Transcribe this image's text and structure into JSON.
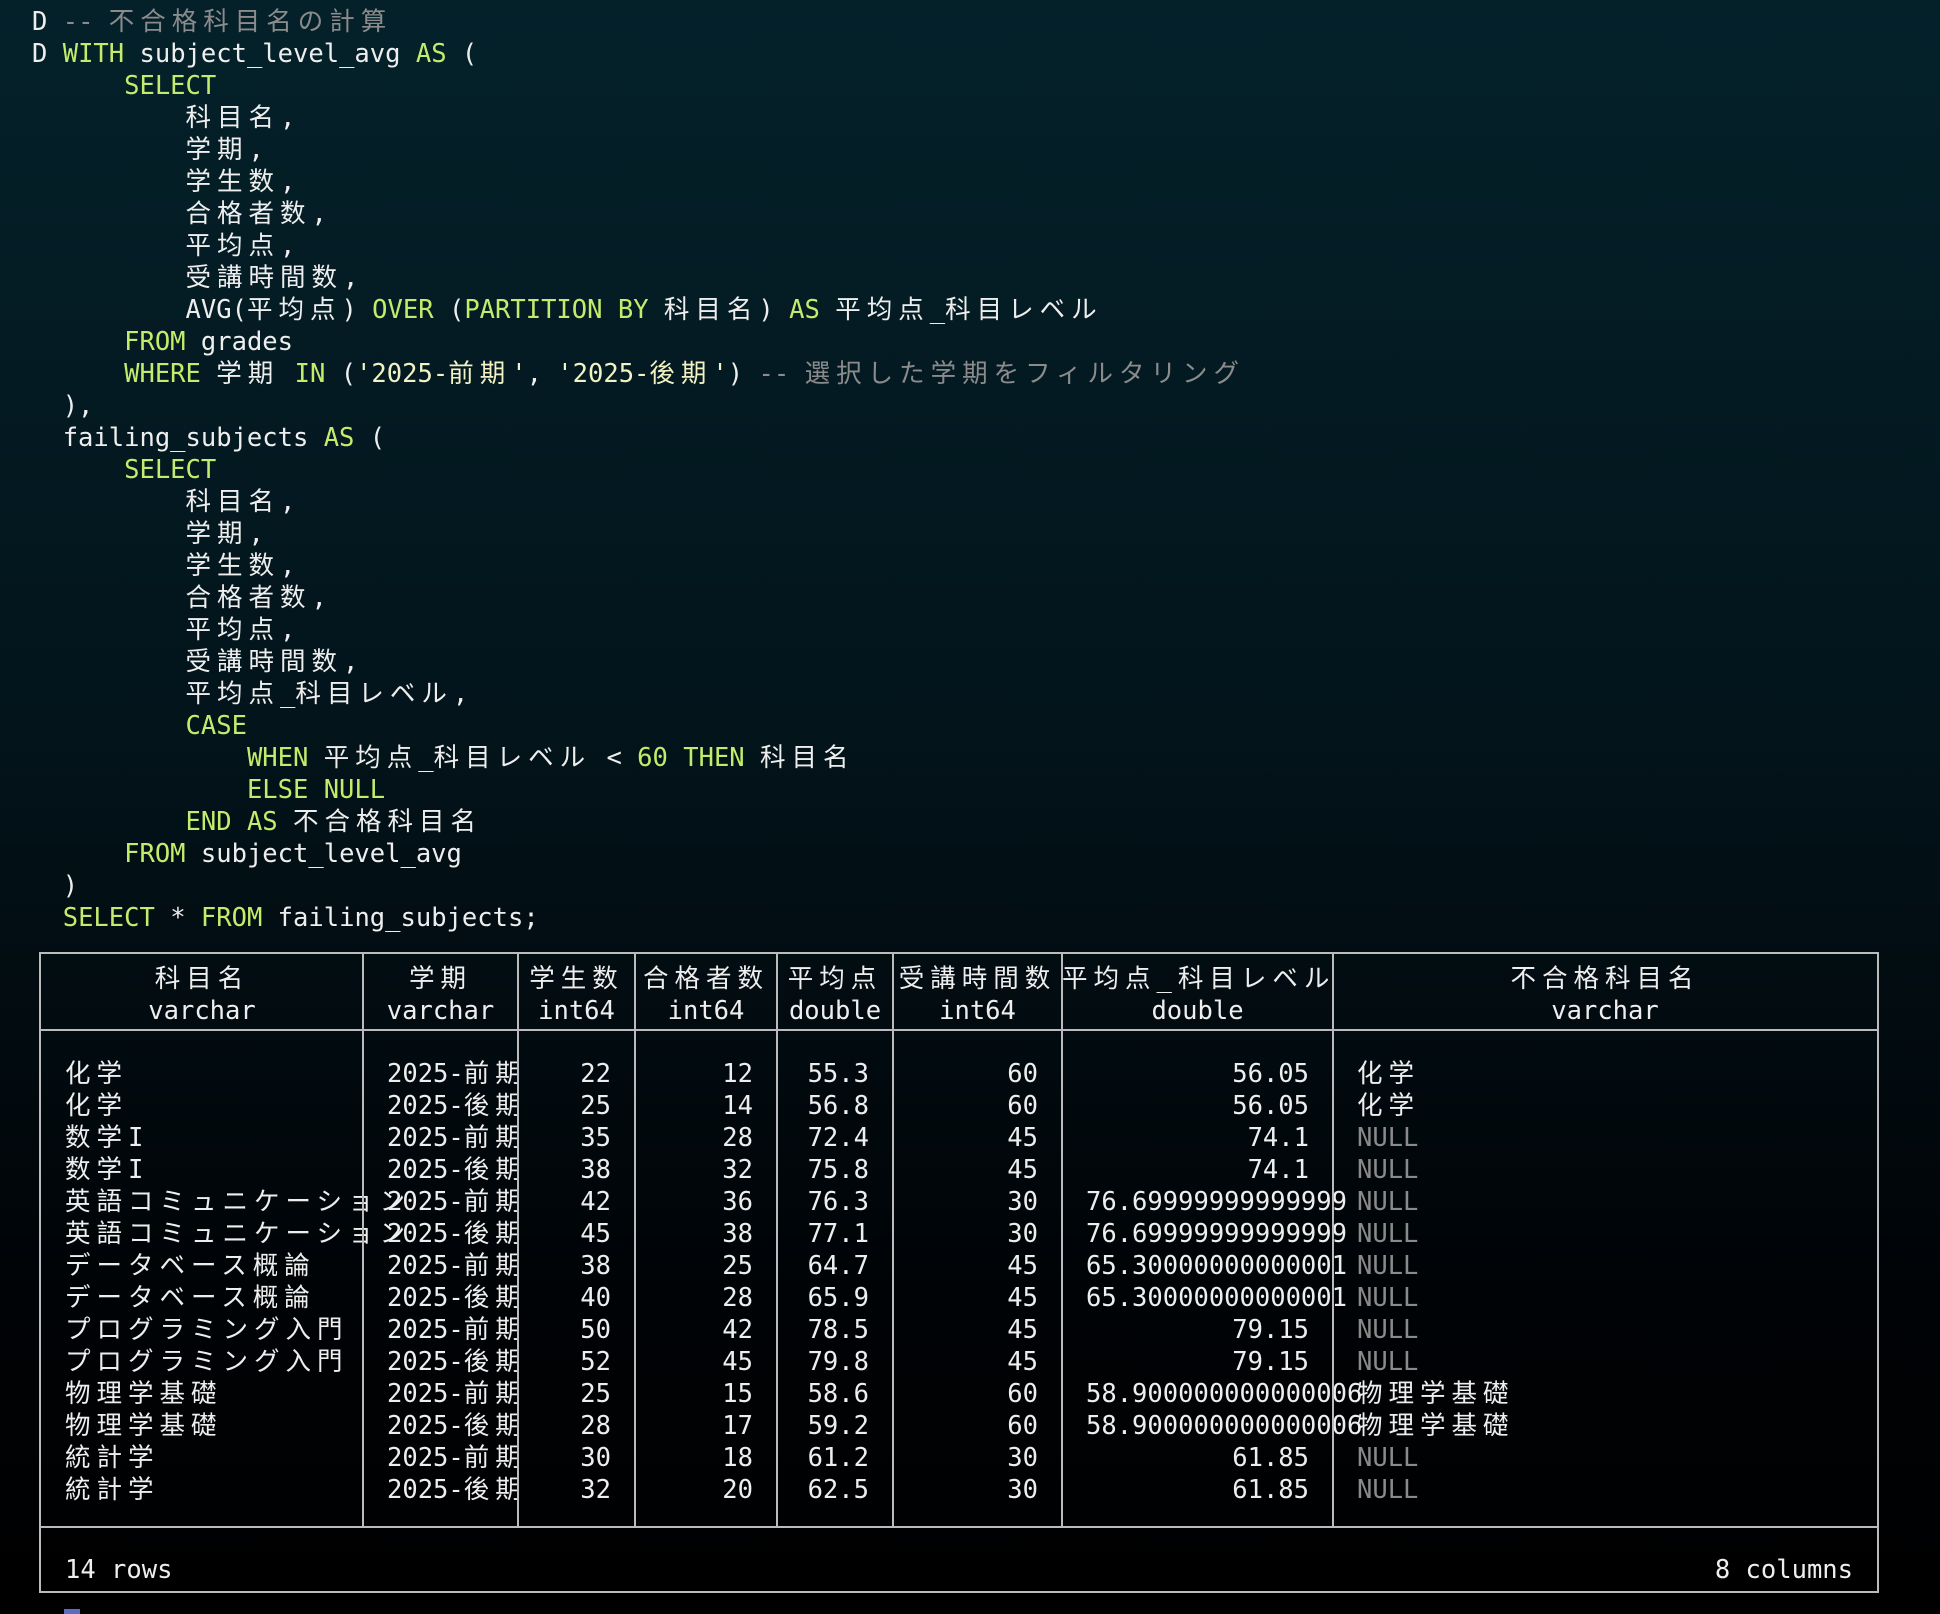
{
  "query_lines": [
    [
      [
        "p",
        "D "
      ],
      [
        "cmt",
        "-- 不合格科目名の計算"
      ]
    ],
    [
      [
        "p",
        "D "
      ],
      [
        "kw",
        "WITH"
      ],
      [
        "p",
        " subject_level_avg "
      ],
      [
        "kw",
        "AS"
      ],
      [
        "p",
        " ("
      ]
    ],
    [
      [
        "p",
        "      "
      ],
      [
        "kw",
        "SELECT"
      ]
    ],
    [
      [
        "p",
        "          科目名,"
      ]
    ],
    [
      [
        "p",
        "          学期,"
      ]
    ],
    [
      [
        "p",
        "          学生数,"
      ]
    ],
    [
      [
        "p",
        "          合格者数,"
      ]
    ],
    [
      [
        "p",
        "          平均点,"
      ]
    ],
    [
      [
        "p",
        "          受講時間数,"
      ]
    ],
    [
      [
        "p",
        "          AVG(平均点) "
      ],
      [
        "kw",
        "OVER"
      ],
      [
        "p",
        " ("
      ],
      [
        "kw",
        "PARTITION BY"
      ],
      [
        "p",
        " 科目名) "
      ],
      [
        "kw",
        "AS"
      ],
      [
        "p",
        " 平均点_科目レベル"
      ]
    ],
    [
      [
        "p",
        "      "
      ],
      [
        "kw",
        "FROM"
      ],
      [
        "p",
        " grades"
      ]
    ],
    [
      [
        "p",
        "      "
      ],
      [
        "kw",
        "WHERE"
      ],
      [
        "p",
        " 学期 "
      ],
      [
        "kw",
        "IN"
      ],
      [
        "p",
        " ("
      ],
      [
        "str",
        "'2025-前期'"
      ],
      [
        "p",
        ", "
      ],
      [
        "str",
        "'2025-後期'"
      ],
      [
        "p",
        ") "
      ],
      [
        "cmt",
        "-- 選択した学期をフィルタリング"
      ]
    ],
    [
      [
        "p",
        "  ),"
      ]
    ],
    [
      [
        "p",
        "  failing_subjects "
      ],
      [
        "kw",
        "AS"
      ],
      [
        "p",
        " ("
      ]
    ],
    [
      [
        "p",
        "      "
      ],
      [
        "kw",
        "SELECT"
      ]
    ],
    [
      [
        "p",
        "          科目名,"
      ]
    ],
    [
      [
        "p",
        "          学期,"
      ]
    ],
    [
      [
        "p",
        "          学生数,"
      ]
    ],
    [
      [
        "p",
        "          合格者数,"
      ]
    ],
    [
      [
        "p",
        "          平均点,"
      ]
    ],
    [
      [
        "p",
        "          受講時間数,"
      ]
    ],
    [
      [
        "p",
        "          平均点_科目レベル,"
      ]
    ],
    [
      [
        "p",
        "          "
      ],
      [
        "kw",
        "CASE"
      ]
    ],
    [
      [
        "p",
        "              "
      ],
      [
        "kw",
        "WHEN"
      ],
      [
        "p",
        " 平均点_科目レベル < "
      ],
      [
        "kw",
        "60"
      ],
      [
        "p",
        " "
      ],
      [
        "kw",
        "THEN"
      ],
      [
        "p",
        " 科目名"
      ]
    ],
    [
      [
        "p",
        "              "
      ],
      [
        "kw",
        "ELSE NULL"
      ]
    ],
    [
      [
        "p",
        "          "
      ],
      [
        "kw",
        "END AS"
      ],
      [
        "p",
        " 不合格科目名"
      ]
    ],
    [
      [
        "p",
        "      "
      ],
      [
        "kw",
        "FROM"
      ],
      [
        "p",
        " subject_level_avg"
      ]
    ],
    [
      [
        "p",
        "  )"
      ]
    ],
    [
      [
        "p",
        "  "
      ],
      [
        "kw",
        "SELECT"
      ],
      [
        "p",
        " * "
      ],
      [
        "kw",
        "FROM"
      ],
      [
        "p",
        " failing_subjects;"
      ]
    ]
  ],
  "result": {
    "columns": [
      {
        "name": "科目名",
        "type": "varchar",
        "align": "left"
      },
      {
        "name": "学期",
        "type": "varchar",
        "align": "left"
      },
      {
        "name": "学生数",
        "type": "int64",
        "align": "right"
      },
      {
        "name": "合格者数",
        "type": "int64",
        "align": "right"
      },
      {
        "name": "平均点",
        "type": "double",
        "align": "right"
      },
      {
        "name": "受講時間数",
        "type": "int64",
        "align": "right"
      },
      {
        "name": "平均点_科目レベル",
        "type": "double",
        "align": "right"
      },
      {
        "name": "不合格科目名",
        "type": "varchar",
        "align": "left"
      }
    ],
    "rows": [
      [
        "化学",
        "2025-前期",
        "22",
        "12",
        "55.3",
        "60",
        "56.05",
        "化学"
      ],
      [
        "化学",
        "2025-後期",
        "25",
        "14",
        "56.8",
        "60",
        "56.05",
        "化学"
      ],
      [
        "数学I",
        "2025-前期",
        "35",
        "28",
        "72.4",
        "45",
        "74.1",
        "NULL"
      ],
      [
        "数学I",
        "2025-後期",
        "38",
        "32",
        "75.8",
        "45",
        "74.1",
        "NULL"
      ],
      [
        "英語コミュニケーション",
        "2025-前期",
        "42",
        "36",
        "76.3",
        "30",
        "76.69999999999999",
        "NULL"
      ],
      [
        "英語コミュニケーション",
        "2025-後期",
        "45",
        "38",
        "77.1",
        "30",
        "76.69999999999999",
        "NULL"
      ],
      [
        "データベース概論",
        "2025-前期",
        "38",
        "25",
        "64.7",
        "45",
        "65.30000000000001",
        "NULL"
      ],
      [
        "データベース概論",
        "2025-後期",
        "40",
        "28",
        "65.9",
        "45",
        "65.30000000000001",
        "NULL"
      ],
      [
        "プログラミング入門",
        "2025-前期",
        "50",
        "42",
        "78.5",
        "45",
        "79.15",
        "NULL"
      ],
      [
        "プログラミング入門",
        "2025-後期",
        "52",
        "45",
        "79.8",
        "45",
        "79.15",
        "NULL"
      ],
      [
        "物理学基礎",
        "2025-前期",
        "25",
        "15",
        "58.6",
        "60",
        "58.900000000000006",
        "物理学基礎"
      ],
      [
        "物理学基礎",
        "2025-後期",
        "28",
        "17",
        "59.2",
        "60",
        "58.900000000000006",
        "物理学基礎"
      ],
      [
        "統計学",
        "2025-前期",
        "30",
        "18",
        "61.2",
        "30",
        "61.85",
        "NULL"
      ],
      [
        "統計学",
        "2025-後期",
        "32",
        "20",
        "62.5",
        "30",
        "61.85",
        "NULL"
      ]
    ],
    "footer": {
      "rows_label": "14 rows",
      "columns_label": "8 columns"
    }
  },
  "colors": {
    "keyword": "#c4ec6c",
    "string": "#f2f2c4",
    "comment": "#8b8b8b",
    "null": "#8a8a8a",
    "border": "#bbbbbb"
  }
}
